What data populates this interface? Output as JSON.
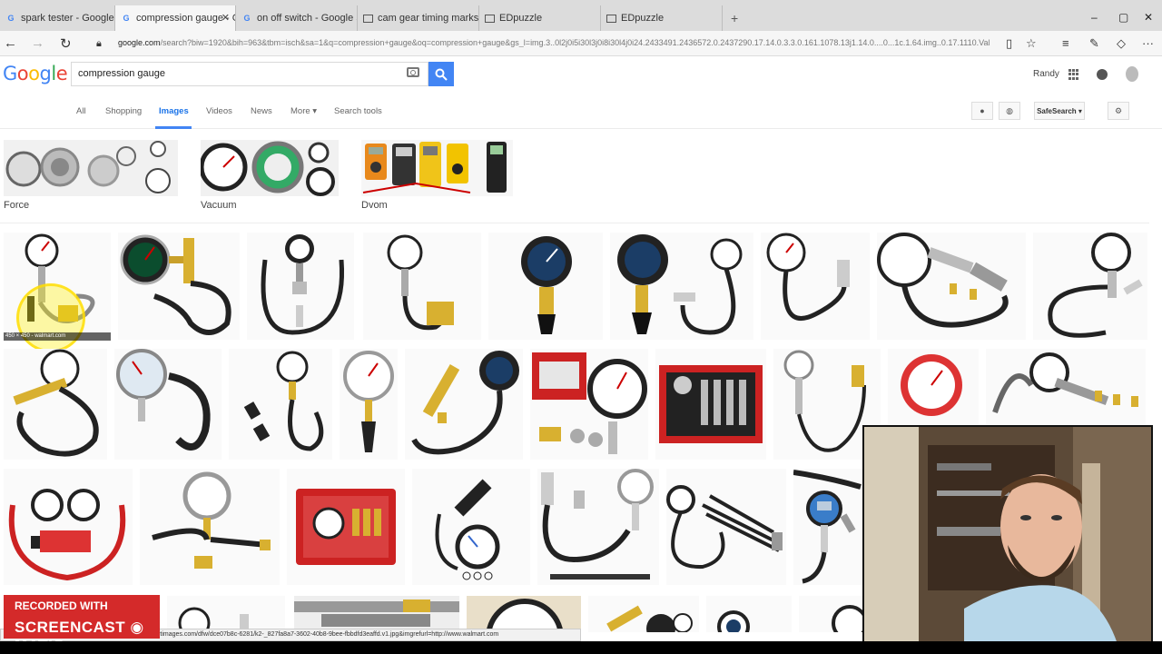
{
  "browser": {
    "tabs": [
      {
        "title": "spark tester - Google Search",
        "favicon": "google-favicon"
      },
      {
        "title": "compression gauge - Go",
        "favicon": "google-favicon",
        "active": true
      },
      {
        "title": "on off switch - Google Searc",
        "favicon": "google-favicon"
      },
      {
        "title": "cam gear timing marks brigg",
        "favicon": "page-favicon"
      },
      {
        "title": "EDpuzzle",
        "favicon": "page-favicon"
      },
      {
        "title": "EDpuzzle",
        "favicon": "page-favicon"
      }
    ],
    "new_tab": "+",
    "window_controls": {
      "minimize": "–",
      "maximize": "▢",
      "close": "✕"
    },
    "url_domain": "google.com",
    "url_rest": "/search?biw=1920&bih=963&tbm=isch&sa=1&q=compression+gauge&oq=compression+gauge&gs_l=img.3..0l2j0i5i30l3j0i8i30l4j0i24.2433491.2436572.0.2437290.17.14.0.3.3.0.161.1078.13j1.14.0....0...1c.1.64.img..0.17.1110.VaNyVZyZfvk"
  },
  "google": {
    "logo_letters": [
      {
        "char": "G",
        "color": "#4285f4"
      },
      {
        "char": "o",
        "color": "#ea4335"
      },
      {
        "char": "o",
        "color": "#fbbc05"
      },
      {
        "char": "g",
        "color": "#4285f4"
      },
      {
        "char": "l",
        "color": "#34a853"
      },
      {
        "char": "e",
        "color": "#ea4335"
      }
    ],
    "query": "compression gauge",
    "user_name": "Randy",
    "nav_tabs": [
      {
        "label": "All"
      },
      {
        "label": "Shopping"
      },
      {
        "label": "Images",
        "active": true
      },
      {
        "label": "Videos"
      },
      {
        "label": "News"
      },
      {
        "label": "More ▾"
      },
      {
        "label": "Search tools"
      }
    ],
    "safesearch": "SafeSearch ▾",
    "related": [
      {
        "label": "Force"
      },
      {
        "label": "Vacuum"
      },
      {
        "label": "Dvom"
      }
    ],
    "hover_caption": "450 × 450 - walmart.com",
    "status_url": "https://www.google.com/imgres?imgurl=http://i5.walmartimages.com/dfw/dce07b8c-6281/k2-_827fa8a7-3602-40b8-9bee-fbbdfd3eaffd.v1.jpg&imgrefurl=http://www.walmart.com"
  },
  "overlay": {
    "recorded_line1": "RECORDED WITH",
    "recorded_line2": "SCREENCAST ◉ MATIC"
  }
}
